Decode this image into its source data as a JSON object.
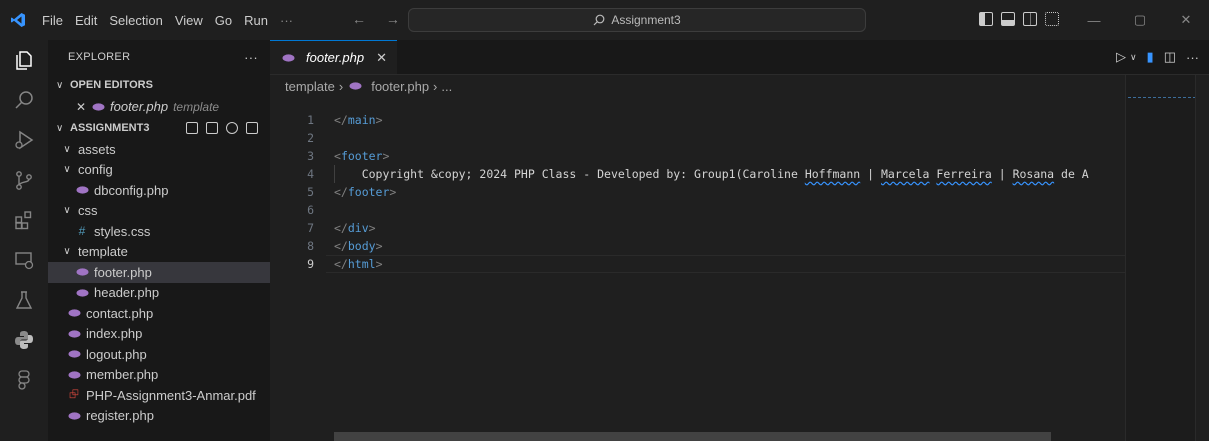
{
  "titlebar": {
    "menu": [
      "File",
      "Edit",
      "Selection",
      "View",
      "Go",
      "Run",
      "···"
    ],
    "nav": "←  →",
    "search": "Assignment3",
    "window": [
      "—",
      "▢",
      "✕"
    ]
  },
  "activity": [
    "explorer-icon",
    "search-icon",
    "run-debug-icon",
    "source-control-icon",
    "extensions-icon",
    "remote-explorer-icon",
    "testing-icon",
    "python-icon",
    "figma-icon"
  ],
  "sidebar": {
    "title": "EXPLORER",
    "more": "···",
    "open_editors": {
      "title": "OPEN EDITORS",
      "item": {
        "name": "footer.php",
        "folder": "template"
      }
    },
    "project": {
      "title": "ASSIGNMENT3",
      "tree": [
        {
          "label": "assets",
          "type": "folder",
          "indent": 1
        },
        {
          "label": "config",
          "type": "folder",
          "indent": 1
        },
        {
          "label": "dbconfig.php",
          "type": "php",
          "indent": 2
        },
        {
          "label": "css",
          "type": "folder",
          "indent": 1
        },
        {
          "label": "styles.css",
          "type": "css",
          "indent": 2
        },
        {
          "label": "template",
          "type": "folder",
          "indent": 1
        },
        {
          "label": "footer.php",
          "type": "php",
          "indent": 2,
          "active": true
        },
        {
          "label": "header.php",
          "type": "php",
          "indent": 2
        },
        {
          "label": "contact.php",
          "type": "php",
          "indent": 1
        },
        {
          "label": "index.php",
          "type": "php",
          "indent": 1
        },
        {
          "label": "logout.php",
          "type": "php",
          "indent": 1
        },
        {
          "label": "member.php",
          "type": "php",
          "indent": 1
        },
        {
          "label": "PHP-Assignment3-Anmar.pdf",
          "type": "pdf",
          "indent": 1
        },
        {
          "label": "register.php",
          "type": "php",
          "indent": 1
        }
      ]
    }
  },
  "editor": {
    "tab": "footer.php",
    "breadcrumb": [
      "template",
      "footer.php",
      "..."
    ],
    "lines": [
      "1",
      "2",
      "3",
      "4",
      "5",
      "6",
      "7",
      "8",
      "9"
    ],
    "code": {
      "l4_a": "    Copyright &copy; 2024 PHP Class - Developed by: Group1(Caroline ",
      "l4_b": "Hoffmann",
      "l4_c": " | ",
      "l4_d": "Marcela",
      "l4_e": " ",
      "l4_f": "Ferreira",
      "l4_g": " | ",
      "l4_h": "Rosana",
      "l4_i": " de A"
    }
  },
  "colors": {
    "accent": "#0078d4",
    "php": "#a074c4",
    "tag": "#569cd6"
  }
}
